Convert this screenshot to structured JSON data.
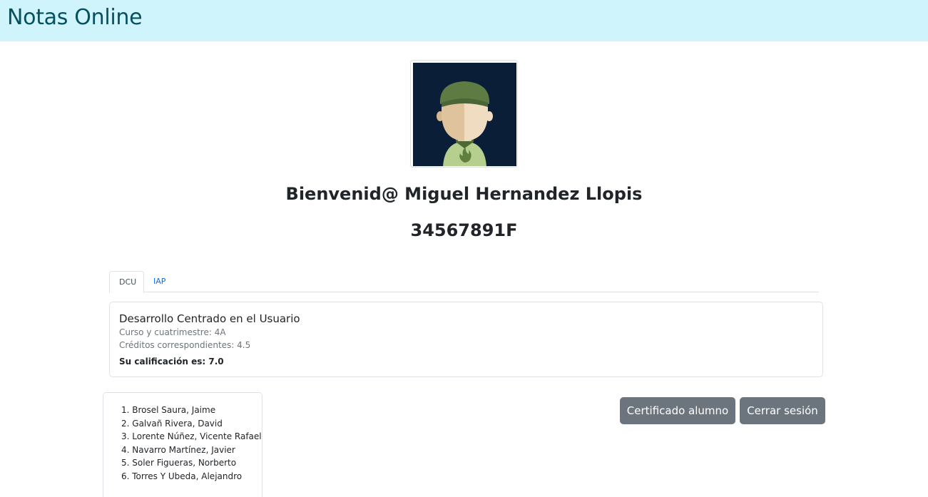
{
  "app": {
    "title": "Notas Online"
  },
  "profile": {
    "welcome": "Bienvenid@ Miguel Hernandez Llopis",
    "dni": "34567891F",
    "avatar_icon": "user-avatar-icon"
  },
  "tabs": [
    {
      "label": "DCU",
      "active": true
    },
    {
      "label": "IAP",
      "active": false
    }
  ],
  "subject": {
    "name": "Desarrollo Centrado en el Usuario",
    "course": "Curso y cuatrimestre: 4A",
    "credits": "Créditos correspondientes: 4.5",
    "grade": "Su calificación es: 7.0"
  },
  "students": [
    "1. Brosel Saura, Jaime",
    "2. Galvañ Rivera, David",
    "3. Lorente Núñez, Vicente Rafael",
    "4. Navarro Martínez, Javier",
    "5. Soler Figueras, Norberto",
    "6. Torres Y Ubeda, Alejandro"
  ],
  "buttons": {
    "certificate": "Certificado alumno",
    "logout": "Cerrar sesión"
  },
  "colors": {
    "header_bg": "#cff4fc",
    "header_text": "#055160",
    "button_bg": "#6c757d",
    "tab_link": "#0d6efd",
    "avatar_bg": "#0b1e38"
  }
}
